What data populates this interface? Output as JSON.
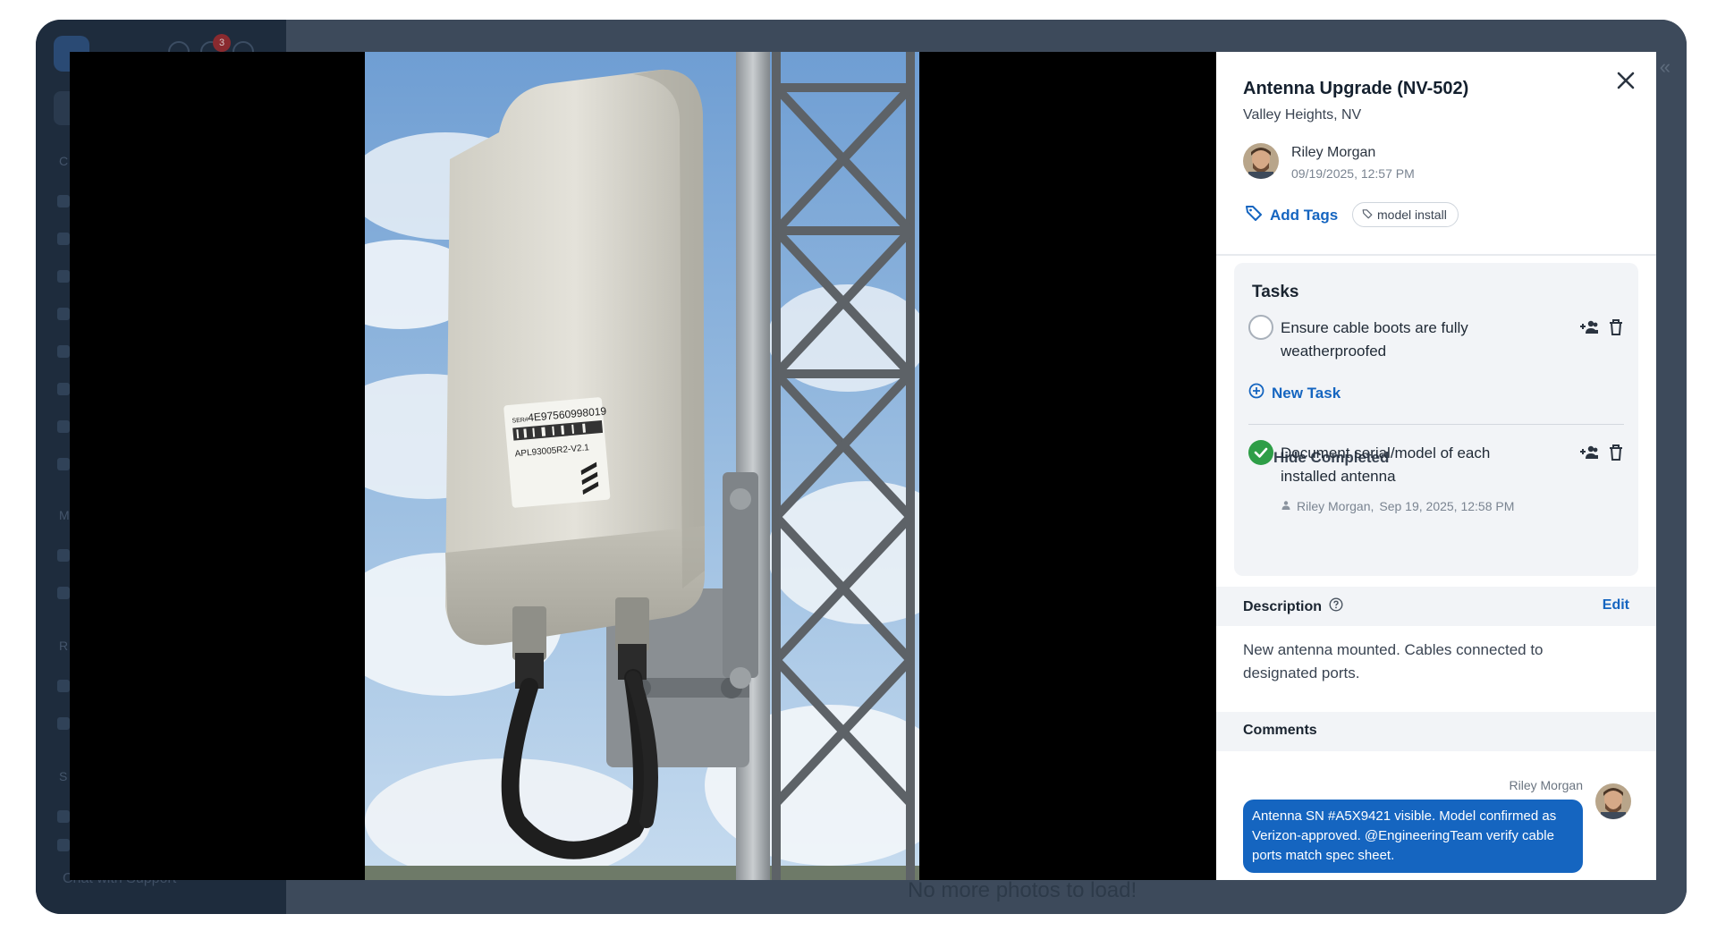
{
  "background": {
    "notification_count": "3",
    "chat_support": "Chat with Support",
    "no_more_photos": "No more photos to load!",
    "sidebar_letters": [
      "C",
      "M",
      "R",
      "S"
    ]
  },
  "photo": {
    "label_serial": "4E975609980​19",
    "label_serial_prefix": "SER#",
    "label_model": "APL93005R2-V2.1"
  },
  "detail": {
    "title": "Antenna Upgrade (NV-502)",
    "location": "Valley Heights, NV",
    "author": {
      "name": "Riley Morgan",
      "date": "09/19/2025, 12:57 PM"
    },
    "add_tags_label": "Add Tags",
    "tags": [
      "model install"
    ],
    "tasks": {
      "title": "Tasks",
      "open": [
        {
          "text": "Ensure cable boots are fully weatherproofed"
        }
      ],
      "new_task_label": "New Task",
      "hide_completed_label": "Hide Completed",
      "completed": [
        {
          "text": "Document serial/model of each installed antenna",
          "completed_by": "Riley Morgan,",
          "completed_at": "Sep 19, 2025, 12:58 PM"
        }
      ]
    },
    "description": {
      "title": "Description",
      "edit_label": "Edit",
      "text": "New antenna mounted. Cables connected to designated ports."
    },
    "comments": {
      "title": "Comments",
      "items": [
        {
          "author": "Riley Morgan",
          "text": "Antenna SN #A5X9421 visible. Model confirmed as Verizon-approved. @EngineeringTeam verify cable ports match spec sheet."
        }
      ]
    }
  },
  "colors": {
    "accent": "#1565c0",
    "success": "#2e9e47",
    "overlay": "#3b4a5c"
  }
}
